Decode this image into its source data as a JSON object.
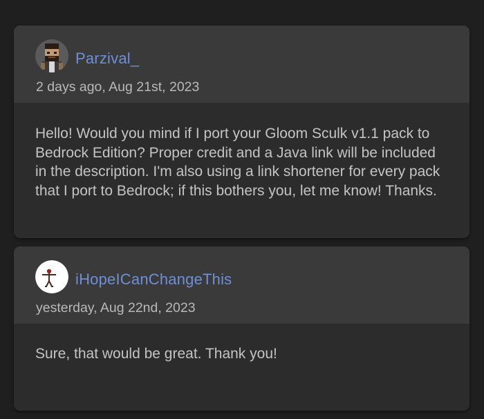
{
  "comments": [
    {
      "username": "Parzival_",
      "timestamp": "2 days ago, Aug 21st, 2023",
      "body": "Hello! Would you mind if I port your Gloom Sculk v1.1 pack to Bedrock Edition? Proper credit and a Java link will be included in the description. I'm also using a link shortener for every pack that I port to Bedrock; if this bothers you, let me know! Thanks.",
      "avatar_icon": "pixel-character-avatar-icon"
    },
    {
      "username": "iHopeICanChangeThis",
      "timestamp": "yesterday, Aug 22nd, 2023",
      "body": "Sure, that would be great. Thank you!",
      "avatar_icon": "stick-figure-avatar-icon"
    }
  ],
  "colors": {
    "background": "#1f1f1f",
    "card": "#2c2c2c",
    "card_header": "#3a3a3a",
    "username": "#6f8fd6",
    "timestamp": "#b9b9b9",
    "body_text": "#c4c4c4"
  }
}
